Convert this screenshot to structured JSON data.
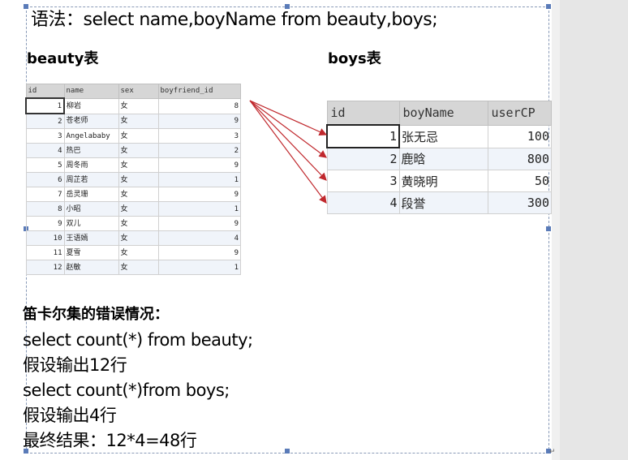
{
  "title": "语法：select  name,boyName from beauty,boys;",
  "beauty_label": "beauty表",
  "boys_label": "boys表",
  "beauty_table": {
    "columns": [
      "id",
      "name",
      "sex",
      "boyfriend_id"
    ],
    "rows": [
      [
        "1",
        "柳岩",
        "女",
        "8"
      ],
      [
        "2",
        "苍老师",
        "女",
        "9"
      ],
      [
        "3",
        "Angelababy",
        "女",
        "3"
      ],
      [
        "4",
        "热巴",
        "女",
        "2"
      ],
      [
        "5",
        "周冬雨",
        "女",
        "9"
      ],
      [
        "6",
        "周芷若",
        "女",
        "1"
      ],
      [
        "7",
        "岳灵珊",
        "女",
        "9"
      ],
      [
        "8",
        "小昭",
        "女",
        "1"
      ],
      [
        "9",
        "双儿",
        "女",
        "9"
      ],
      [
        "10",
        "王语嫣",
        "女",
        "4"
      ],
      [
        "11",
        "夏雪",
        "女",
        "9"
      ],
      [
        "12",
        "赵敏",
        "女",
        "1"
      ]
    ]
  },
  "boys_table": {
    "columns": [
      "id",
      "boyName",
      "userCP"
    ],
    "rows": [
      [
        "1",
        "张无忌",
        "100"
      ],
      [
        "2",
        "鹿晗",
        "800"
      ],
      [
        "3",
        "黄晓明",
        "50"
      ],
      [
        "4",
        "段誉",
        "300"
      ]
    ]
  },
  "notes": {
    "heading": "笛卡尔集的错误情况：",
    "lines": [
      "select count(*) from beauty;",
      "假设输出12行",
      "select count(*)from boys;",
      "假设输出4行",
      "最终结果：12*4=48行"
    ]
  },
  "colors": {
    "arrow": "#c0282d",
    "header_bg": "#d6d6d6",
    "selection_border": "#5a7bb8"
  }
}
